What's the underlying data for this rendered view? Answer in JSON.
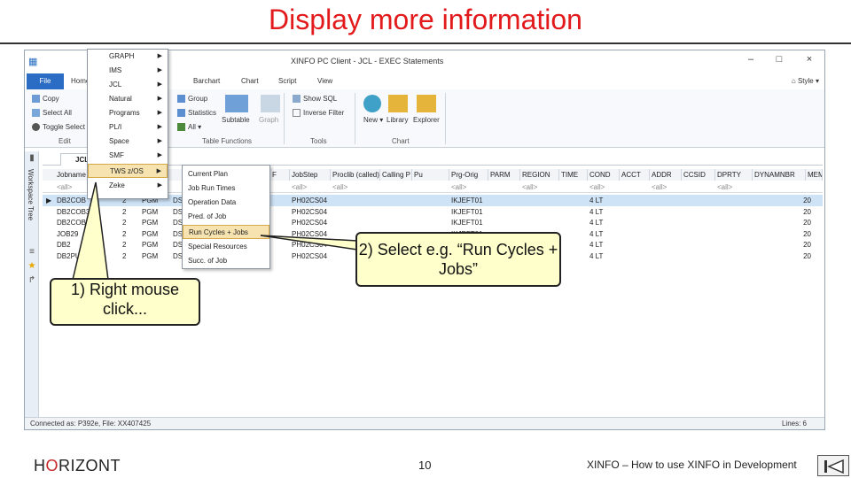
{
  "slide": {
    "title": "Display more information",
    "page_number": "10",
    "footer_text": "XINFO – How to use XINFO in Development",
    "logo_h": "H",
    "logo_o": "O",
    "logo_rest": "RIZONT"
  },
  "app": {
    "title": "XINFO PC Client - JCL - EXEC Statements",
    "menu": {
      "file": "File",
      "home": "Home",
      "barchart": "Barchart",
      "chart": "Chart",
      "script": "Script",
      "view": "View",
      "style": "Style"
    },
    "ribbon": {
      "copy": "Copy",
      "select_all": "Select All",
      "toggle_select": "Toggle Select",
      "edit_group": "Edit",
      "group": "Group",
      "statistics": "Statistics",
      "all": "All",
      "subtable": "Subtable",
      "graph": "Graph",
      "table_functions_group": "Table Functions",
      "show_sql": "Show SQL",
      "inverse_filter": "Inverse Filter",
      "tools_group": "Tools",
      "new": "New",
      "library": "Library",
      "explorer": "Explorer",
      "chart_group": "Chart"
    },
    "sidebar": {
      "label": "Workspace Tree"
    },
    "tab": {
      "label": "JCL"
    },
    "context_menu": [
      "GRAPH",
      "IMS",
      "JCL",
      "Natural",
      "Programs",
      "PL/I",
      "Space",
      "SMF",
      "TWS z/OS",
      "Zeke"
    ],
    "submenu": [
      "Current Plan",
      "Job Run Times",
      "Operation Data",
      "Pred. of Job",
      "Run Cycles + Jobs",
      "Special Resources",
      "Succ. of Job"
    ],
    "grid": {
      "columns": [
        "Jobname",
        "",
        "",
        "",
        "",
        "",
        "",
        "",
        "F",
        "JobStep",
        "Proclib (called)",
        "Calling P",
        "Pu",
        "Prg-Orig",
        "PARM",
        "REGION",
        "TIME",
        "COND",
        "ACCT",
        "ADDR",
        "CCSID",
        "DPRTY",
        "DYNAMNBR",
        "MEM"
      ],
      "filter_all": "<all>",
      "rows": [
        [
          "DB2COB",
          "2",
          "PGM",
          "DSN",
          "PH02CS04",
          "",
          "IKJEFT01",
          "4 LT",
          "20"
        ],
        [
          "DB2COB3",
          "2",
          "PGM",
          "DSN",
          "PH02CS04",
          "",
          "IKJEFT01",
          "4 LT",
          "20"
        ],
        [
          "DB2COB3",
          "2",
          "PGM",
          "DSN",
          "PH02CS04",
          "",
          "IKJEFT01",
          "4 LT",
          "20"
        ],
        [
          "JOB29",
          "2",
          "PGM",
          "DSN",
          "PH02CS04",
          "",
          "IKJEFT01",
          "4 LT",
          "20"
        ],
        [
          "DB2",
          "2",
          "PGM",
          "DSN",
          "PH02CS04",
          "",
          "",
          "4 LT",
          "20"
        ],
        [
          "DB2PU",
          "2",
          "PGM",
          "DSN",
          "PH02CS04",
          "",
          "",
          "4 LT",
          "20"
        ]
      ]
    },
    "status": {
      "left": "Connected as: P392e, File: XX407425",
      "right": "Lines: 6"
    }
  },
  "callouts": {
    "right_click": "1) Right mouse click...",
    "select": "2) Select e.g. “Run Cycles + Jobs”"
  }
}
